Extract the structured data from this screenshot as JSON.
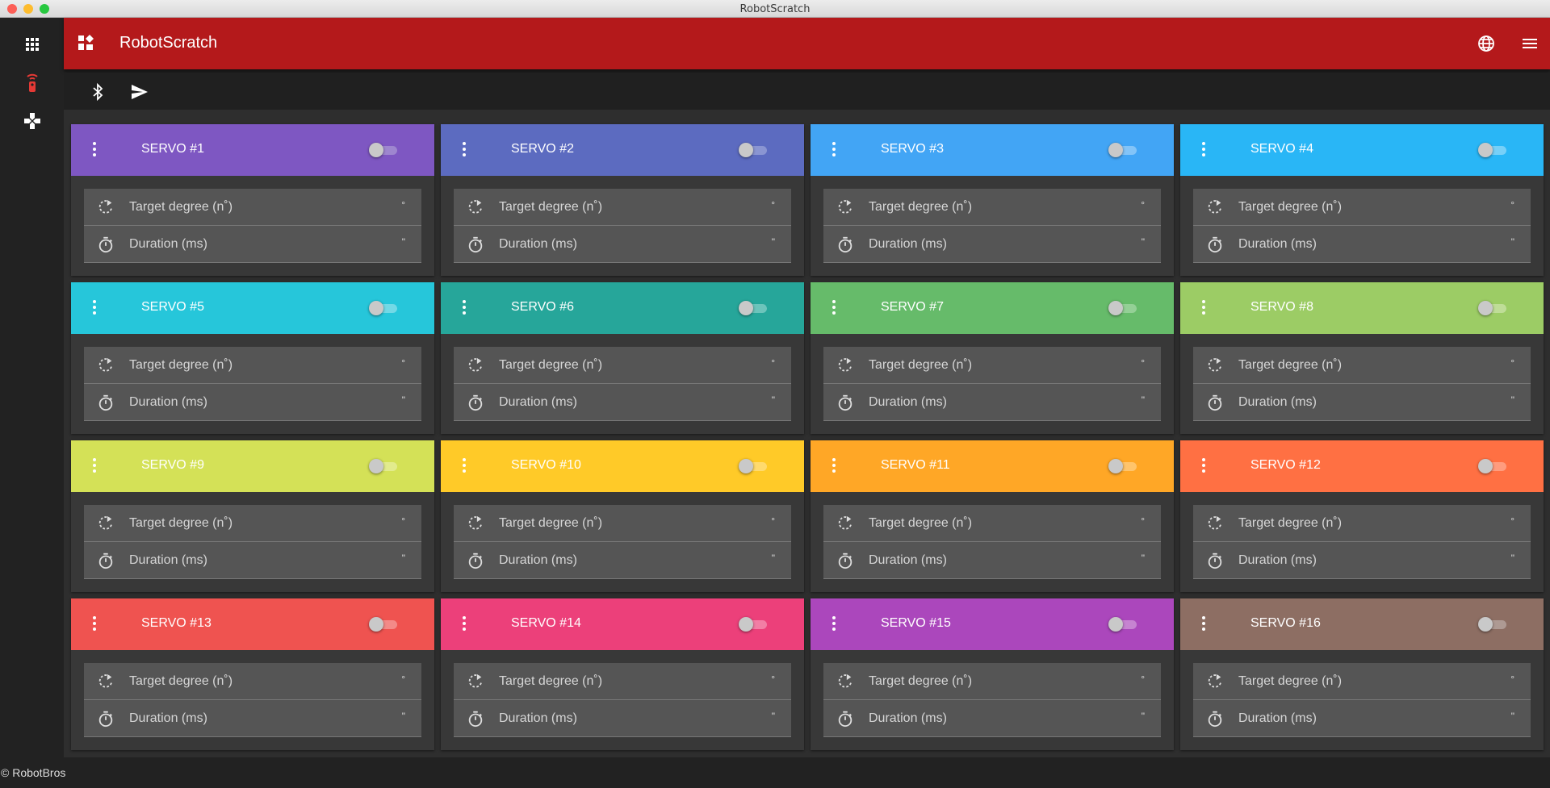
{
  "window": {
    "title": "RobotScratch"
  },
  "appbar": {
    "title": "RobotScratch"
  },
  "sidebar": {
    "items": [
      "apps-icon",
      "remote-icon",
      "gamepad-icon"
    ]
  },
  "toolbar": {
    "items": [
      "bluetooth-icon",
      "send-icon"
    ]
  },
  "fields": {
    "target_label": "Target degree (n˚)",
    "target_unit": "°",
    "duration_label": "Duration (ms)",
    "duration_unit": "\""
  },
  "servos": [
    {
      "title": "SERVO #1",
      "color": "#7e57c2",
      "track": "#9e86cf",
      "enabled": false
    },
    {
      "title": "SERVO #2",
      "color": "#5c6bc0",
      "track": "#8a95d2",
      "enabled": false
    },
    {
      "title": "SERVO #3",
      "color": "#42a5f5",
      "track": "#83c4f8",
      "enabled": false
    },
    {
      "title": "SERVO #4",
      "color": "#29b6f6",
      "track": "#77d0f8",
      "enabled": false
    },
    {
      "title": "SERVO #5",
      "color": "#26c6da",
      "track": "#72d9e6",
      "enabled": false
    },
    {
      "title": "SERVO #6",
      "color": "#26a69a",
      "track": "#6cc4bb",
      "enabled": false
    },
    {
      "title": "SERVO #7",
      "color": "#66bb6a",
      "track": "#94d096",
      "enabled": false
    },
    {
      "title": "SERVO #8",
      "color": "#9ccc65",
      "track": "#bfdd97",
      "enabled": false
    },
    {
      "title": "SERVO #9",
      "color": "#d4e157",
      "track": "#e2eb8d",
      "enabled": false
    },
    {
      "title": "SERVO #10",
      "color": "#ffca28",
      "track": "#ffda6e",
      "enabled": false
    },
    {
      "title": "SERVO #11",
      "color": "#ffa726",
      "track": "#ffc46b",
      "enabled": false
    },
    {
      "title": "SERVO #12",
      "color": "#ff7043",
      "track": "#ff9c7e",
      "enabled": false
    },
    {
      "title": "SERVO #13",
      "color": "#ef5350",
      "track": "#f38a88",
      "enabled": false
    },
    {
      "title": "SERVO #14",
      "color": "#ec407a",
      "track": "#f27ea5",
      "enabled": false
    },
    {
      "title": "SERVO #15",
      "color": "#ab47bc",
      "track": "#c683d1",
      "enabled": false
    },
    {
      "title": "SERVO #16",
      "color": "#8d6e63",
      "track": "#ae9a93",
      "enabled": false
    }
  ],
  "footer": {
    "text": "© RobotBros"
  }
}
